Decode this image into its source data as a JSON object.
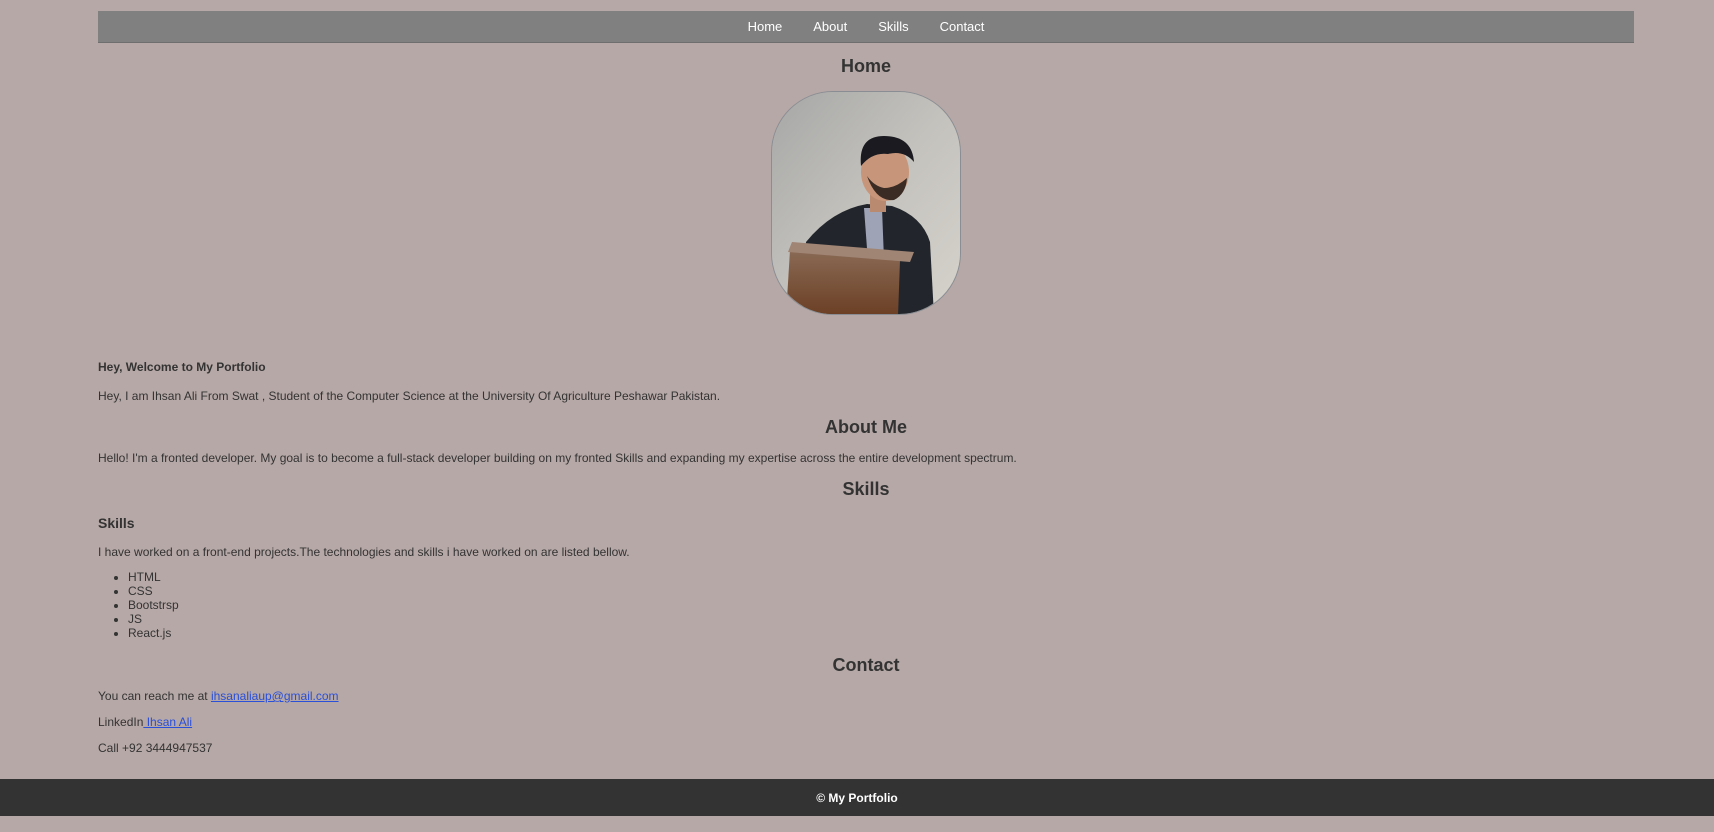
{
  "nav": {
    "links": [
      "Home",
      "About",
      "Skills",
      "Contact"
    ]
  },
  "home": {
    "title": "Home",
    "welcome": "Hey, Welcome to My Portfolio",
    "intro": "Hey, I am Ihsan Ali From Swat , Student of the Computer Science at the University Of Agriculture Peshawar Pakistan."
  },
  "about": {
    "title": "About Me",
    "text": "Hello! I'm a fronted developer. My goal is to become a full-stack developer building on my fronted Skills and expanding my expertise across the entire development spectrum."
  },
  "skills": {
    "title": "Skills",
    "subtitle": "Skills",
    "text": "I have worked on a front-end projects.The technologies and skills i have worked on are listed bellow.",
    "items": [
      "HTML",
      "CSS",
      "Bootstrsp",
      "JS",
      "React.js"
    ]
  },
  "contact": {
    "title": "Contact",
    "email_prefix": "You can reach me at ",
    "email": "ihsanaliaup@gmail.com",
    "linkedin_prefix": "LinkedIn",
    "linkedin_name": " Ihsan Ali",
    "phone": "Call +92 3444947537"
  },
  "footer": {
    "text": "© My Portfolio"
  },
  "colors": {
    "background": "#b6a8a6",
    "navbar": "#808080",
    "footer": "#333333",
    "link": "#2a4fd8"
  }
}
